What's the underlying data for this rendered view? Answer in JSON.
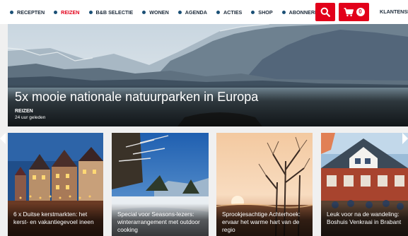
{
  "nav": {
    "items": [
      {
        "label": "RECEPTEN"
      },
      {
        "label": "REIZEN"
      },
      {
        "label": "B&B SELECTIE"
      },
      {
        "label": "WONEN"
      },
      {
        "label": "AGENDA"
      },
      {
        "label": "ACTIES"
      },
      {
        "label": "SHOP"
      },
      {
        "label": "ABONNEREN"
      }
    ],
    "active_index": 1,
    "search_icon": "search-icon",
    "cart_icon": "cart-icon",
    "cart_count": "0",
    "account_label": "KLANTENSER"
  },
  "colors": {
    "accent": "#e2001a",
    "nav_dot": "#1a4f75",
    "nav_text": "#1d2b3a"
  },
  "hero": {
    "title": "5x mooie nationale natuurparken in Europa",
    "category": "REIZEN",
    "time": "24 uur geleden"
  },
  "cards": [
    {
      "title": "6 x Duitse kerstmarkten: het kerst- en vakantiegevoel ineen"
    },
    {
      "title": "Special voor Seasons-lezers: winterarrangement met outdoor cooking"
    },
    {
      "title": "Sprookjesachtige Achterhoek: ervaar het warme hart van de regio"
    },
    {
      "title": "Leuk voor na de wandeling: Boshuis Venkraai in Brabant"
    }
  ]
}
